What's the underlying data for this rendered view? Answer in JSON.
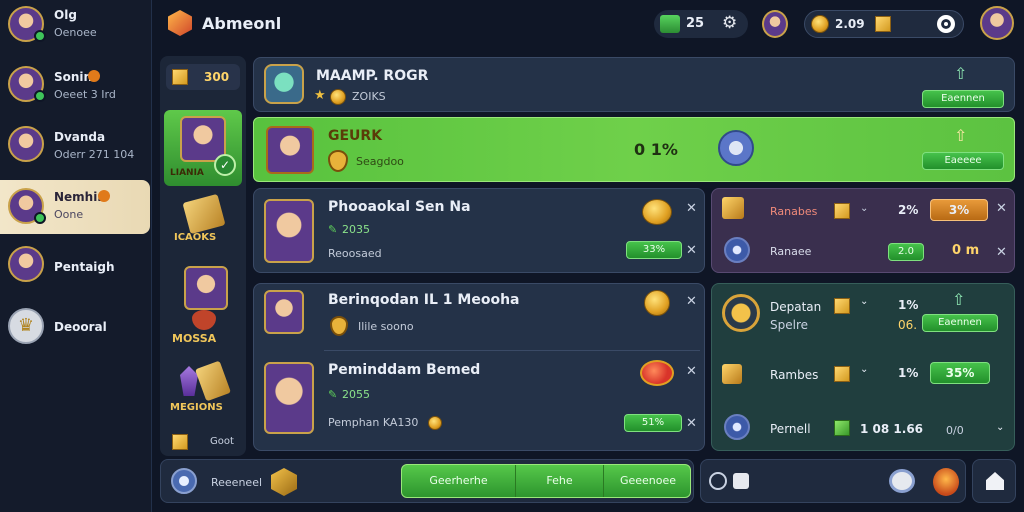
{
  "sidebar": {
    "items": [
      {
        "name": "Olg",
        "sub": "Oenoee"
      },
      {
        "name": "Sonin",
        "sub": "Oeeet 3 Ird"
      },
      {
        "name": "Dvanda",
        "sub": "Oderr 271 104"
      },
      {
        "name": "Nemhin",
        "sub": "Oone"
      },
      {
        "name": "Pentaigh",
        "sub": ""
      },
      {
        "name": "Deooral",
        "sub": ""
      }
    ]
  },
  "header": {
    "title": "Abmeonl",
    "gems": "25",
    "coins": "2.09"
  },
  "categories": {
    "gold": "300",
    "items": [
      "LIANIA",
      "ICAOKS",
      "MOSSA",
      "MEGIONS",
      "Goot"
    ]
  },
  "rows": {
    "r1": {
      "title": "MAAMP. ROGR",
      "sub": "ZOIKS",
      "button": "Eaennen"
    },
    "r2": {
      "title": "GEURK",
      "sub": "Seagdoo",
      "value": "0 1%",
      "button": "Eaeeee"
    },
    "r3": {
      "title": "Phooaokal Sen Na",
      "line2": "2035",
      "line3": "Reoosaed",
      "pill": "33%"
    },
    "r4": {
      "title": "Berinqodan IL 1 Meooha",
      "sub": "Ilile soono"
    },
    "r5": {
      "title": "Peminddam Bemed",
      "line2": "2055",
      "line3": "Pemphan KA130",
      "pill": "51%"
    }
  },
  "right_top": {
    "r1": {
      "label": "Ranabes",
      "pct": "2%",
      "button": "3%"
    },
    "r2": {
      "label": "Ranaee",
      "pill": "2.0",
      "value": "0 m"
    }
  },
  "right_bottom": {
    "r1": {
      "label": "Depatan",
      "label2": "Spelre",
      "pct": "1%",
      "sub": "06.",
      "button": "Eaennen"
    },
    "r2": {
      "label": "Rambes",
      "pct": "1%",
      "button": "35%"
    },
    "r3": {
      "label": "Pernell",
      "value": "1 08 1.66",
      "value2": "0/0"
    }
  },
  "bottom_bar": {
    "label": "Reeeneel",
    "tabs": [
      "Geerherhe",
      "Fehe",
      "Geeenoee"
    ]
  },
  "colors": {
    "bg": "#0f1626",
    "panel": "#243248",
    "highlight": "#6fd04a",
    "accent_orange": "#d9892a"
  }
}
